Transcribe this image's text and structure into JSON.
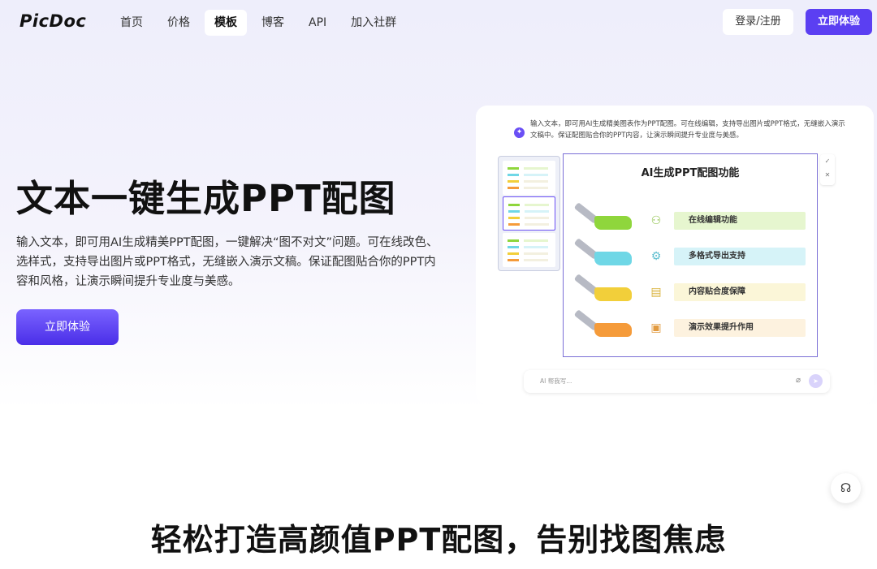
{
  "nav": {
    "logo": "PicDoc",
    "links": [
      "首页",
      "价格",
      "模板",
      "博客",
      "API",
      "加入社群"
    ],
    "active_index": 2,
    "login_label": "登录/注册",
    "try_label": "立即体验"
  },
  "hero": {
    "title": "文本一键生成PPT配图",
    "description": "输入文本，即可用AI生成精美PPT配图，一键解决“图不对文”问题。可在线改色、选样式，支持导出图片或PPT格式，无缝嵌入演示文稿。保证配图贴合你的PPT内容和风格，让演示瞬间提升专业度与美感。",
    "button_label": "立即体验"
  },
  "preview": {
    "prompt_text": "输入文本，即可用AI生成精美图表作为PPT配图。可在线编辑，支持导出图片或PPT格式，无缝嵌入演示文稿中。保证配图贴合你的PPT内容，让演示瞬间提升专业度与美感。",
    "slide_title": "AI生成PPT配图功能",
    "features": [
      {
        "label": "在线编辑功能",
        "icon": "people-icon",
        "bar_color": "#e6f6cf",
        "brush_color": "#8fd63c"
      },
      {
        "label": "多格式导出支持",
        "icon": "network-icon",
        "bar_color": "#d6f3f8",
        "brush_color": "#6fd7e6"
      },
      {
        "label": "内容贴合度保障",
        "icon": "document-icon",
        "bar_color": "#fbf6d8",
        "brush_color": "#f2cf3a"
      },
      {
        "label": "演示效果提升作用",
        "icon": "presentation-icon",
        "bar_color": "#fdf2df",
        "brush_color": "#f59b3a"
      }
    ],
    "chat_placeholder": "AI 帮我写...",
    "accent": "#6a4ff5"
  },
  "section": {
    "title": "轻松打造高颜值PPT配图，告别找图焦虑"
  }
}
